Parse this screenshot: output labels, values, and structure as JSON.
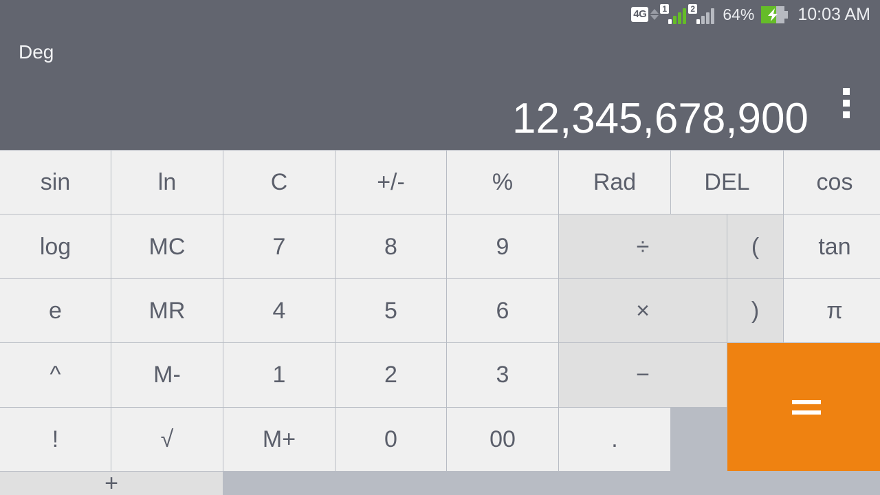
{
  "status_bar": {
    "network_badge": "4G",
    "data_arrows_icon": "data-transfer-arrows-icon",
    "sim1_label": "1",
    "sim2_label": "2",
    "sim1_signal_bars": 4,
    "sim2_signal_bars": 4,
    "battery_percent_label": "64%",
    "battery_level": 64,
    "battery_charging": true,
    "clock": "10:03 AM"
  },
  "display": {
    "angle_mode": "Deg",
    "result": "12,345,678,900",
    "overflow_menu_icon": "overflow-menu-icon"
  },
  "colors": {
    "header_bg": "#62656f",
    "key_bg": "#f0f0f0",
    "operator_bg": "#e0e0e0",
    "equals_bg": "#ef8211",
    "key_text": "#5b5f6b",
    "grid_line": "#b8bcc4",
    "signal_green": "#65bc28"
  },
  "keypad": {
    "row1": [
      {
        "label": "sin",
        "type": "func"
      },
      {
        "label": "ln",
        "type": "func"
      },
      {
        "label": "C",
        "type": "func"
      },
      {
        "label": "+/-",
        "type": "func"
      },
      {
        "label": "%",
        "type": "func"
      },
      {
        "label": "Rad",
        "type": "func"
      },
      {
        "label": "DEL",
        "type": "func"
      }
    ],
    "row2": [
      {
        "label": "cos",
        "type": "func"
      },
      {
        "label": "log",
        "type": "func"
      },
      {
        "label": "MC",
        "type": "func"
      },
      {
        "label": "7",
        "type": "digit"
      },
      {
        "label": "8",
        "type": "digit"
      },
      {
        "label": "9",
        "type": "digit"
      },
      {
        "label": "÷",
        "type": "op"
      },
      {
        "label": "(",
        "type": "paren"
      }
    ],
    "row3": [
      {
        "label": "tan",
        "type": "func"
      },
      {
        "label": "e",
        "type": "func"
      },
      {
        "label": "MR",
        "type": "func"
      },
      {
        "label": "4",
        "type": "digit"
      },
      {
        "label": "5",
        "type": "digit"
      },
      {
        "label": "6",
        "type": "digit"
      },
      {
        "label": "×",
        "type": "op"
      },
      {
        "label": ")",
        "type": "paren"
      }
    ],
    "row4": [
      {
        "label": "π",
        "type": "func"
      },
      {
        "label": "^",
        "type": "func"
      },
      {
        "label": "M-",
        "type": "func"
      },
      {
        "label": "1",
        "type": "digit"
      },
      {
        "label": "2",
        "type": "digit"
      },
      {
        "label": "3",
        "type": "digit"
      },
      {
        "label": "−",
        "type": "op"
      },
      {
        "label": "=",
        "type": "equals"
      }
    ],
    "row5": [
      {
        "label": "!",
        "type": "func"
      },
      {
        "label": "√",
        "type": "func"
      },
      {
        "label": "M+",
        "type": "func"
      },
      {
        "label": "0",
        "type": "digit"
      },
      {
        "label": "00",
        "type": "digit"
      },
      {
        "label": ".",
        "type": "digit"
      },
      {
        "label": "+",
        "type": "op"
      }
    ]
  }
}
